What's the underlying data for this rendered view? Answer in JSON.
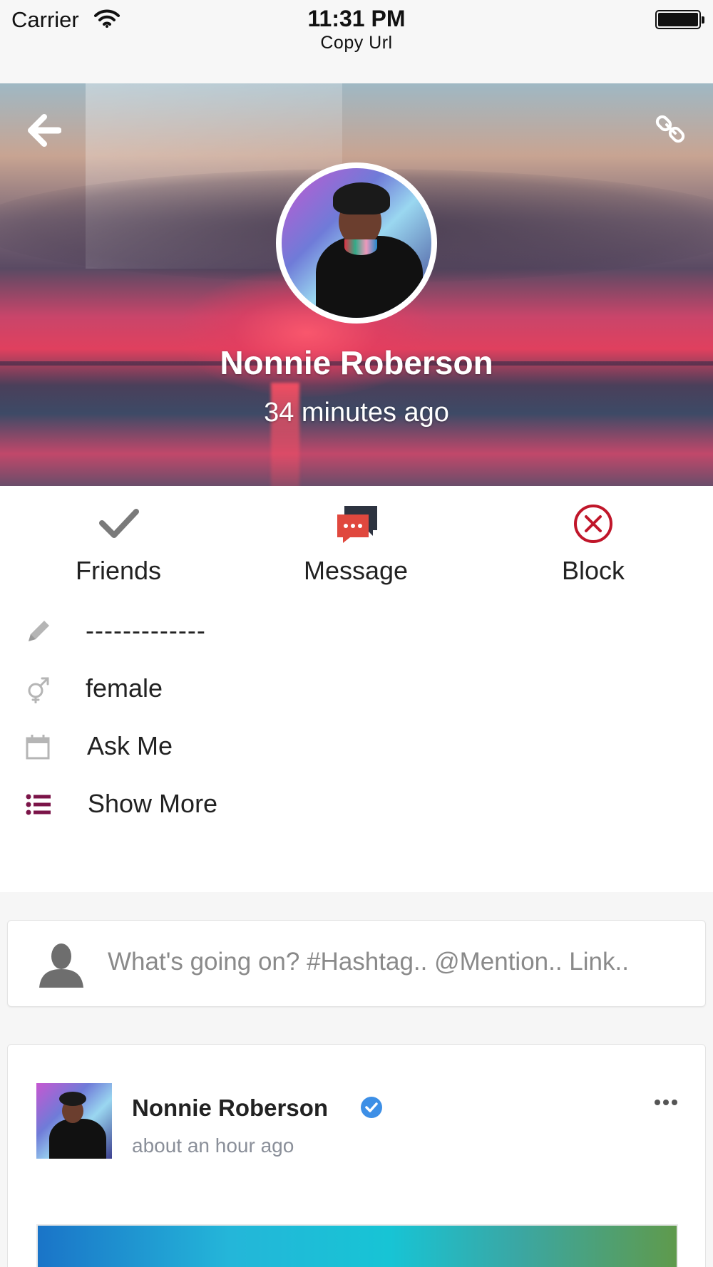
{
  "status_bar": {
    "carrier": "Carrier",
    "time": "11:31 PM",
    "subtitle": "Copy Url",
    "icons": [
      "wifi-icon",
      "battery-icon"
    ]
  },
  "header": {
    "back_icon": "back-arrow-icon",
    "link_icon": "link-icon",
    "name": "Nonnie Roberson",
    "last_seen": "34 minutes ago"
  },
  "actions": [
    {
      "label": "Friends",
      "icon": "checkmark-icon",
      "color": "#7a7a7a"
    },
    {
      "label": "Message",
      "icon": "chat-bubbles-icon",
      "color": "#e0483e"
    },
    {
      "label": "Block",
      "icon": "block-x-circle-icon",
      "color": "#c0162a"
    }
  ],
  "info": {
    "about": "-------------",
    "gender": "female",
    "birthday": "Ask Me",
    "show_more": "Show More",
    "accent_color": "#7b1448"
  },
  "composer": {
    "placeholder": "What's going on? #Hashtag.. @Mention.. Link.."
  },
  "post": {
    "author": "Nonnie Roberson",
    "time": "about an hour ago",
    "verified_color": "#3d8fe6"
  }
}
